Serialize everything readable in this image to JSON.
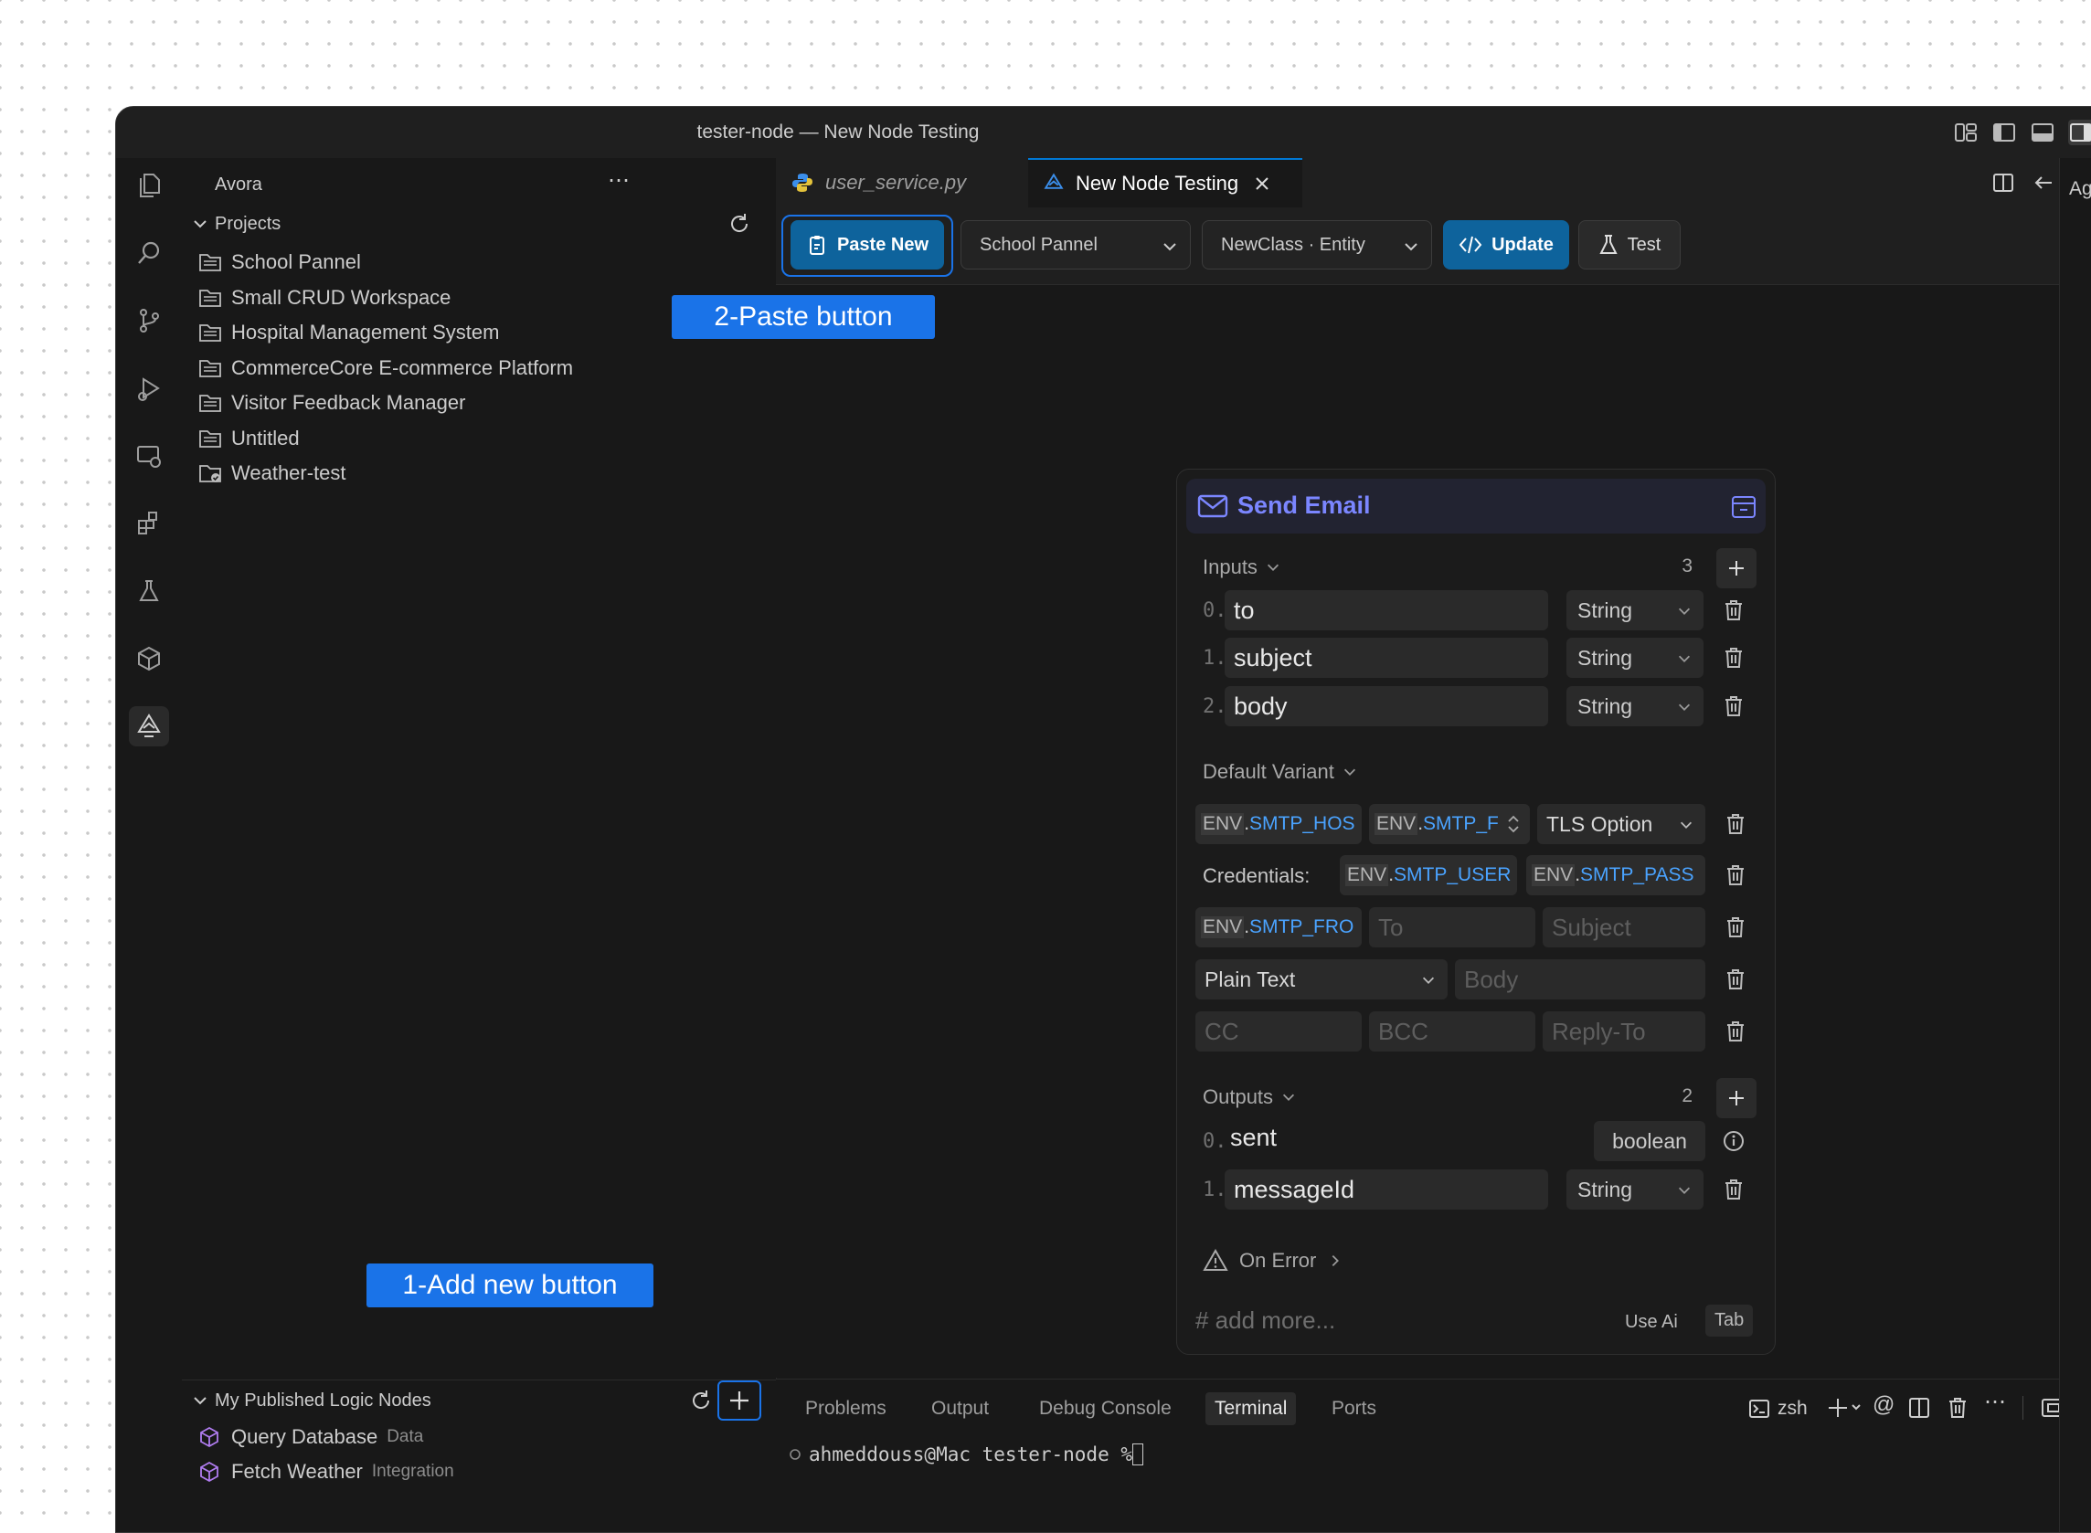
{
  "window": {
    "title": "tester-node — New Node Testing"
  },
  "sidebar": {
    "title": "Avora",
    "projects_label": "Projects",
    "projects": [
      {
        "label": "School Pannel"
      },
      {
        "label": "Small CRUD Workspace"
      },
      {
        "label": "Hospital Management System"
      },
      {
        "label": "CommerceCore E-commerce Platform"
      },
      {
        "label": "Visitor Feedback Manager"
      },
      {
        "label": "Untitled"
      },
      {
        "label": "Weather-test"
      }
    ],
    "published_label": "My Published Logic Nodes",
    "published": [
      {
        "label": "Query Database",
        "tag": "Data"
      },
      {
        "label": "Fetch Weather",
        "tag": "Integration"
      }
    ]
  },
  "tabs": [
    {
      "label": "user_service.py",
      "active": false
    },
    {
      "label": "New Node Testing",
      "active": true
    }
  ],
  "toolbar": {
    "paste_label": "Paste New",
    "project_select": "School Pannel",
    "class_select": "NewClass · Entity",
    "update_label": "Update",
    "test_label": "Test"
  },
  "callouts": {
    "paste": "2-Paste button",
    "add": "1-Add new button"
  },
  "node": {
    "title": "Send Email",
    "inputs_label": "Inputs",
    "inputs_count": "3",
    "inputs": [
      {
        "idx": "0.",
        "name": "to",
        "type": "String"
      },
      {
        "idx": "1.",
        "name": "subject",
        "type": "String"
      },
      {
        "idx": "2.",
        "name": "body",
        "type": "String"
      }
    ],
    "variant_label": "Default Variant",
    "env_prefix": "ENV",
    "env_host": "SMTP_HOS",
    "env_port": "SMTP_F",
    "tls_option": "TLS Option",
    "credentials_label": "Credentials:",
    "env_user": "SMTP_USER",
    "env_pass": "SMTP_PASS",
    "env_from": "SMTP_FRO",
    "to_placeholder": "To",
    "subject_placeholder": "Subject",
    "content_type": "Plain Text",
    "body_placeholder": "Body",
    "cc_placeholder": "CC",
    "bcc_placeholder": "BCC",
    "reply_placeholder": "Reply-To",
    "outputs_label": "Outputs",
    "outputs_count": "2",
    "outputs": [
      {
        "idx": "0.",
        "name": "sent",
        "type": "boolean"
      },
      {
        "idx": "1.",
        "name": "messageId",
        "type": "String"
      }
    ],
    "on_error_label": "On Error",
    "add_more_placeholder": "# add more...",
    "use_ai_label": "Use Ai",
    "tab_label": "Tab"
  },
  "panel": {
    "tabs": [
      "Problems",
      "Output",
      "Debug Console",
      "Terminal",
      "Ports"
    ],
    "active_tab": "Terminal",
    "shell": "zsh",
    "prompt": "ahmeddouss@Mac tester-node % "
  },
  "right_edge_text": "Ag",
  "colors": {
    "accent": "#0e639c",
    "callout": "#1a73e8",
    "node_title": "#7b86ff",
    "env_value": "#4aa3ff"
  }
}
